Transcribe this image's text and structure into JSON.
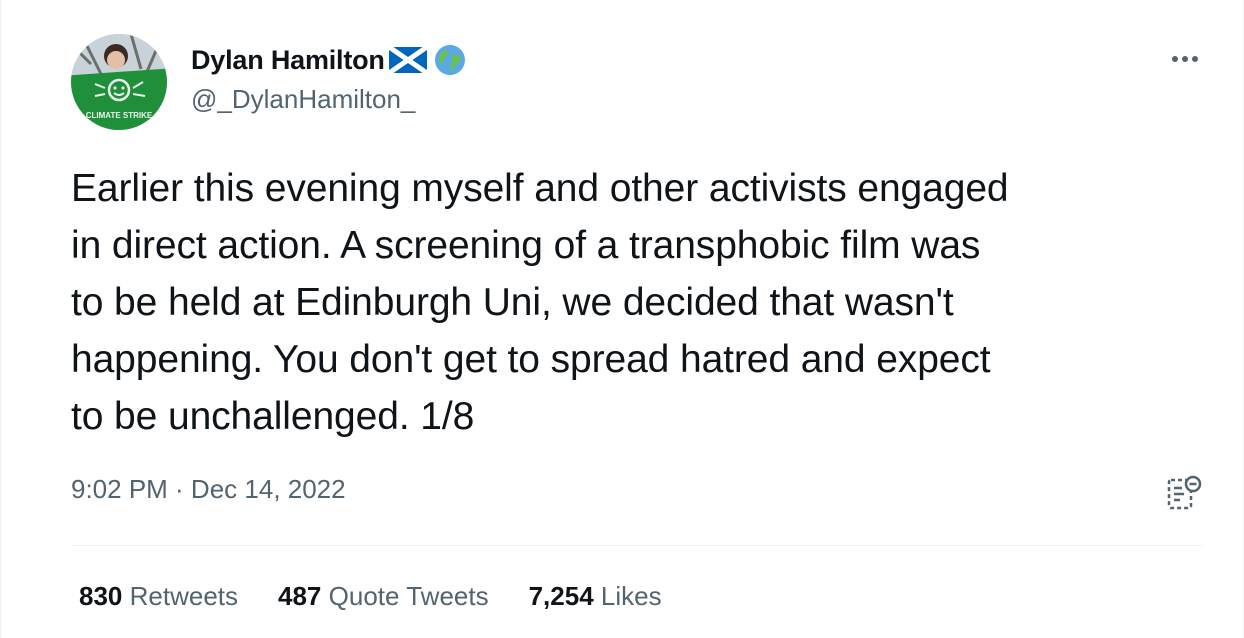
{
  "author": {
    "display_name": "Dylan Hamilton",
    "handle": "@_DylanHamilton_",
    "name_emojis": [
      "scotland-flag-icon",
      "globe-icon"
    ],
    "avatar_banner_text": "CLIMATE STRIKE"
  },
  "tweet": {
    "text": "Earlier this evening myself and other activists engaged\nin direct action. A screening of a transphobic film was\nto be held at Edinburgh Uni, we decided that wasn't\nhappening. You don't get to spread hatred and expect\nto be unchallenged. 1/8",
    "timestamp": "9:02 PM · Dec 14, 2022"
  },
  "stats": {
    "retweets": {
      "count": "830",
      "label": "Retweets"
    },
    "quotes": {
      "count": "487",
      "label": "Quote Tweets"
    },
    "likes": {
      "count": "7,254",
      "label": "Likes"
    }
  },
  "colors": {
    "text_primary": "#0f1419",
    "text_secondary": "#536471",
    "divider": "#eff3f4",
    "flag_blue": "#0065bd",
    "banner_green": "#1f8f3a"
  }
}
